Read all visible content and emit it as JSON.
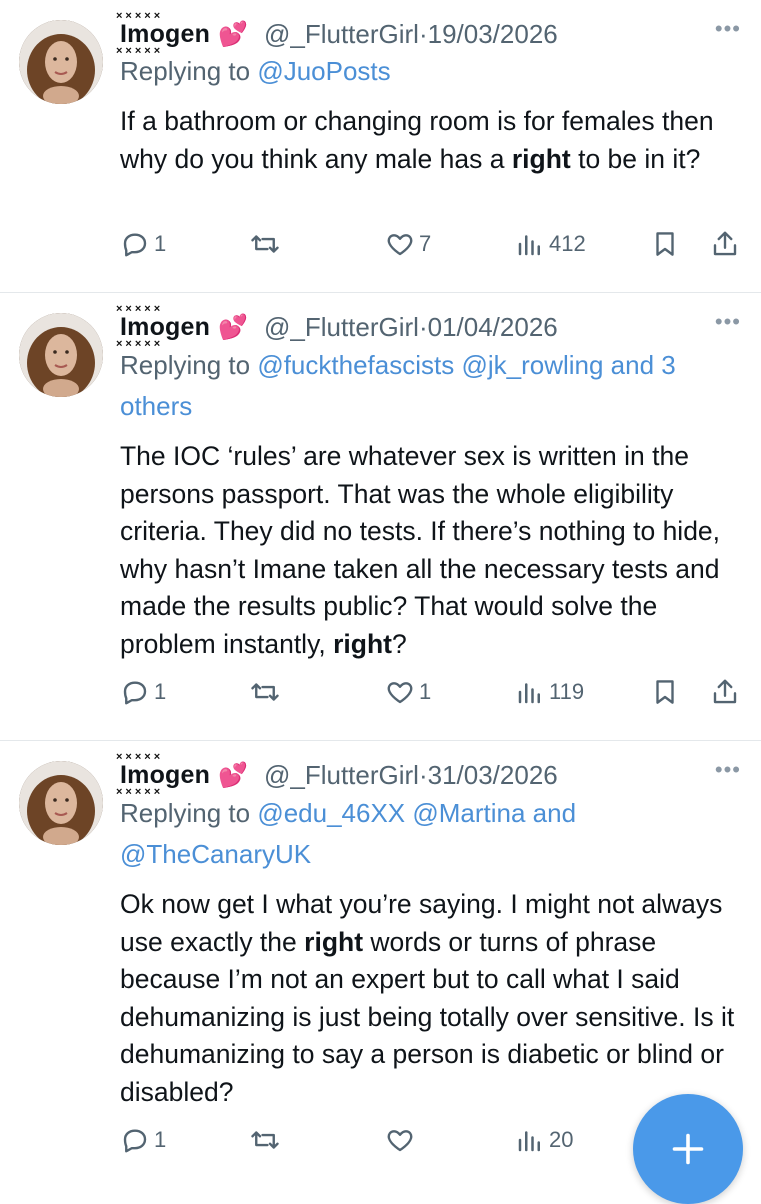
{
  "tweets": [
    {
      "display_name": "Imogen",
      "name_marks": "×××××",
      "heart": "💕",
      "handle_date": "@_FlutterGirl·19/03/2026",
      "replying_prefix": "Replying to ",
      "mentions_line1": "@JuoPosts",
      "mentions_line2": "",
      "body_before": "If a bathroom or changing room is for females then why do you think any male has a ",
      "body_bold": "right",
      "body_after": " to be in it?",
      "replies": "1",
      "retweets": "",
      "likes": "7",
      "views": "412"
    },
    {
      "display_name": "Imogen",
      "name_marks": "×××××",
      "heart": "💕",
      "handle_date": "@_FlutterGirl·01/04/2026",
      "replying_prefix": "Replying to ",
      "mentions_line1": "@fuckthefascists @jk_rowling and 3",
      "mentions_line2": "others",
      "body_before": "The IOC ‘rules’ are whatever sex is written in the persons passport. That was the whole eligibility criteria. They did no tests. If there’s nothing to hide, why hasn’t Imane taken all the necessary tests and made the results public? That would solve the problem instantly, ",
      "body_bold": "right",
      "body_after": "?",
      "replies": "1",
      "retweets": "",
      "likes": "1",
      "views": "119"
    },
    {
      "display_name": "Imogen",
      "name_marks": "×××××",
      "heart": "💕",
      "handle_date": "@_FlutterGirl·31/03/2026",
      "replying_prefix": "Replying to ",
      "mentions_line1": "@edu_46XX @Martina and",
      "mentions_line2": "@TheCanaryUK",
      "body_before": "Ok now get I what you’re saying. I might not always use exactly the ",
      "body_bold": "right",
      "body_after": " words or turns of phrase because I’m not an expert but to call what I said dehumanizing is just being totally over sensitive. Is it dehumanizing to say a person is diabetic or blind or disabled?",
      "replies": "1",
      "retweets": "",
      "likes": "",
      "views": "20"
    }
  ],
  "more_glyph": "•••",
  "icons": {
    "reply": "reply-icon",
    "retweet": "retweet-icon",
    "like": "heart-icon",
    "views": "views-icon",
    "bookmark": "bookmark-icon",
    "share": "share-icon",
    "compose": "plus-icon"
  },
  "colors": {
    "link": "#4b8fd6",
    "muted": "#536471",
    "fab": "#4a99e9",
    "heart_emoji": "#e0457b"
  }
}
